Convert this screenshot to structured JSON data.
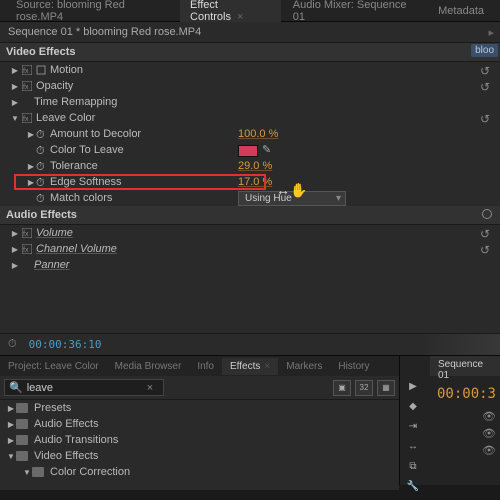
{
  "top_tabs": {
    "source": "Source: blooming Red rose.MP4",
    "effect_controls": "Effect Controls",
    "audio_mixer": "Audio Mixer: Sequence 01",
    "metadata": "Metadata"
  },
  "sequence_label": "Sequence 01 * blooming Red rose.MP4",
  "tc_chip": "bloo",
  "sections": {
    "video": "Video Effects",
    "audio": "Audio Effects"
  },
  "effects": {
    "motion": "Motion",
    "opacity": "Opacity",
    "time_remap": "Time Remapping",
    "leave_color": "Leave Color",
    "volume": "Volume",
    "channel_volume": "Channel Volume",
    "panner": "Panner"
  },
  "params": {
    "amount_to_decolor": {
      "label": "Amount to Decolor",
      "value": "100.0 %"
    },
    "color_to_leave": {
      "label": "Color To Leave",
      "color": "#d43a5a"
    },
    "tolerance": {
      "label": "Tolerance",
      "value": "29.0 %"
    },
    "edge_softness": {
      "label": "Edge Softness",
      "value": "17.0 %"
    },
    "match_colors": {
      "label": "Match colors",
      "value": "Using Hue"
    }
  },
  "timecode": "00:00:36:10",
  "bottom_tabs": {
    "project": "Project: Leave Color",
    "media_browser": "Media Browser",
    "info": "Info",
    "effects": "Effects",
    "markers": "Markers",
    "history": "History"
  },
  "search": {
    "value": "leave",
    "btn32": "32"
  },
  "browser": {
    "presets": "Presets",
    "audio_effects": "Audio Effects",
    "audio_transitions": "Audio Transitions",
    "video_effects": "Video Effects",
    "color_correction": "Color Correction"
  },
  "right": {
    "tab": "Sequence 01",
    "timecode": "00:00:3"
  }
}
